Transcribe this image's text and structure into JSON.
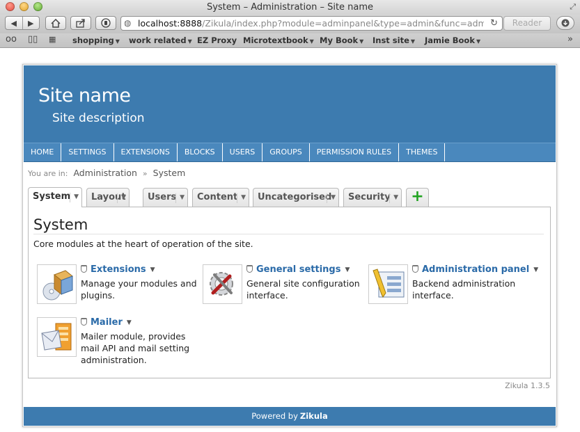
{
  "window": {
    "title": "System – Administration – Site name"
  },
  "toolbar": {
    "url_host": "localhost:8888",
    "url_rest": "/Zikula/index.php?module=adminpanel&type=admin&func=adminpar",
    "reader_label": "Reader"
  },
  "bookmarks": [
    {
      "label": "shopping",
      "has_menu": true
    },
    {
      "label": "work related",
      "has_menu": true
    },
    {
      "label": "EZ Proxy",
      "has_menu": false
    },
    {
      "label": "Microtextbook",
      "has_menu": true
    },
    {
      "label": "My Book",
      "has_menu": true
    },
    {
      "label": "Inst site",
      "has_menu": true
    },
    {
      "label": "Jamie Book",
      "has_menu": true
    }
  ],
  "site": {
    "name": "Site name",
    "description": "Site description"
  },
  "nav": [
    "HOME",
    "SETTINGS",
    "EXTENSIONS",
    "BLOCKS",
    "USERS",
    "GROUPS",
    "PERMISSION RULES",
    "THEMES"
  ],
  "breadcrumb": {
    "prefix": "You are in:",
    "items": [
      "Administration",
      "System"
    ],
    "separator": "»"
  },
  "tabs": [
    {
      "label": "System",
      "active": true
    },
    {
      "label": "Layout",
      "active": false
    },
    {
      "label": "Users",
      "active": false
    },
    {
      "label": "Content",
      "active": false
    },
    {
      "label": "Uncategorised",
      "active": false
    },
    {
      "label": "Security",
      "active": false
    }
  ],
  "add_tab_label": "+",
  "content": {
    "title": "System",
    "description": "Core modules at the heart of operation of the site.",
    "modules": [
      {
        "title": "Extensions",
        "description": "Manage your modules and plugins.",
        "icon": "extensions-icon"
      },
      {
        "title": "General settings",
        "description": "General site configuration interface.",
        "icon": "settings-icon"
      },
      {
        "title": "Administration panel",
        "description": "Backend administration interface.",
        "icon": "admin-panel-icon"
      },
      {
        "title": "Mailer",
        "description": "Mailer module, provides mail API and mail setting administration.",
        "icon": "mailer-icon"
      }
    ]
  },
  "version": "Zikula 1.3.5",
  "footer": {
    "prefix": "Powered by",
    "brand": "Zikula"
  },
  "colors": {
    "header": "#3d7baf",
    "nav": "#4a88bd",
    "link": "#2a6aa8",
    "add": "#21a321"
  }
}
